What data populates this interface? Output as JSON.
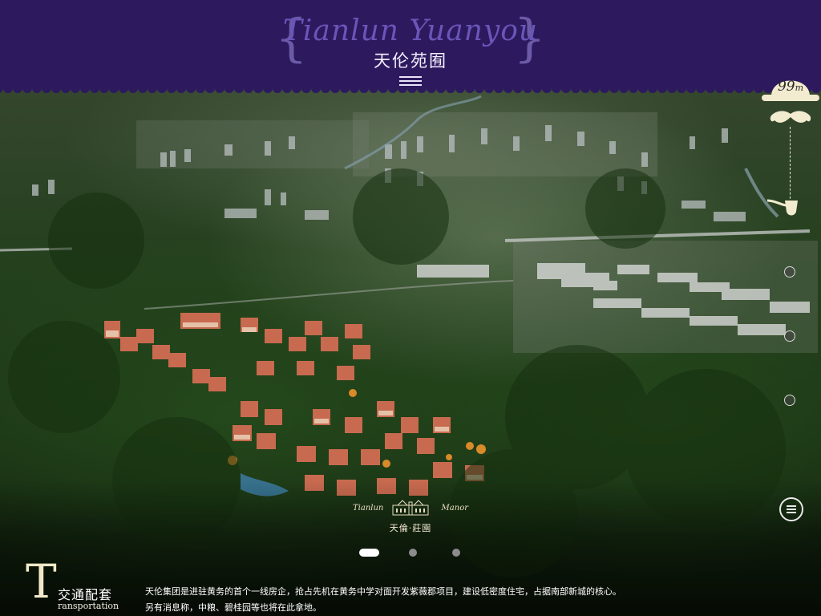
{
  "header": {
    "brand_latin": "Tianlun Yuanyou",
    "brand_cn": "天伦苑囿",
    "menu_toggle_icon": "menu-lines-icon",
    "background_color": "#2d1a5e"
  },
  "scroll_indicator": {
    "value": "99",
    "unit": "m",
    "icons": [
      "bowler-hat-icon",
      "mustache-icon",
      "pipe-icon"
    ]
  },
  "side_nav": {
    "dots": 3,
    "menu_icon": "hamburger-circle-icon"
  },
  "manor_logo": {
    "latin_left": "Tianlun",
    "latin_right": "Manor",
    "cn": "天倫·莊園"
  },
  "carousel": {
    "page_count": 3,
    "active_index": 0
  },
  "section": {
    "initial": "T",
    "title_cn": "交通配套",
    "title_en": "ransportation"
  },
  "description": {
    "line1": "天伦集团是进驻黄务的首个一线房企，抢占先机在黄务中学对面开发紫薇郡项目，建设低密度住宅，占据南部新城的核心。",
    "line2": "另有消息称，中粮、碧桂园等也将在此拿地。"
  }
}
